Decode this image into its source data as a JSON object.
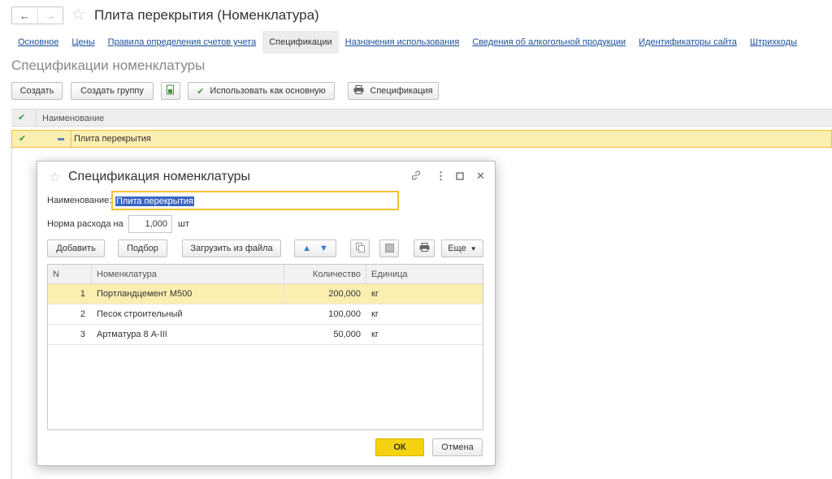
{
  "header": {
    "title": "Плита перекрытия (Номенклатура)",
    "back": "←",
    "forward": "→",
    "star": "☆"
  },
  "tabs": [
    {
      "label": "Основное"
    },
    {
      "label": "Цены"
    },
    {
      "label": "Правила определения счетов учета"
    },
    {
      "label": "Спецификации",
      "active": true
    },
    {
      "label": "Назначения использования"
    },
    {
      "label": "Сведения об алкогольной продукции"
    },
    {
      "label": "Идентификаторы сайта"
    },
    {
      "label": "Штрихкоды"
    }
  ],
  "section_title": "Спецификации номенклатуры",
  "toolbar": {
    "create": "Создать",
    "create_group": "Создать группу",
    "use_as_main": "Использовать как основную",
    "specification": "Спецификация"
  },
  "list": {
    "column": "Наименование",
    "rows": [
      {
        "name": "Плита перекрытия"
      }
    ]
  },
  "dialog": {
    "title": "Спецификация номенклатуры",
    "name_label": "Наименование:",
    "name_value": "Плита перекрытия",
    "norm_label": "Норма расхода на",
    "norm_value": "1,000",
    "norm_unit": "шт",
    "buttons": {
      "add": "Добавить",
      "pick": "Подбор",
      "load": "Загрузить из файла",
      "more": "Еще"
    },
    "table": {
      "headers": [
        "N",
        "Номенклатура",
        "Количество",
        "Единица"
      ],
      "rows": [
        {
          "n": "1",
          "item": "Портландцемент М500",
          "qty": "200,000",
          "unit": "кг"
        },
        {
          "n": "2",
          "item": "Песок строительный",
          "qty": "100,000",
          "unit": "кг"
        },
        {
          "n": "3",
          "item": "Артматура 8 A-III",
          "qty": "50,000",
          "unit": "кг"
        }
      ]
    },
    "ok": "ОК",
    "cancel": "Отмена"
  },
  "colors": {
    "accent_yellow": "#f5d20f",
    "selection": "#fbeeb1",
    "link": "#1b4f9c",
    "check_green": "#3a9a3a"
  }
}
